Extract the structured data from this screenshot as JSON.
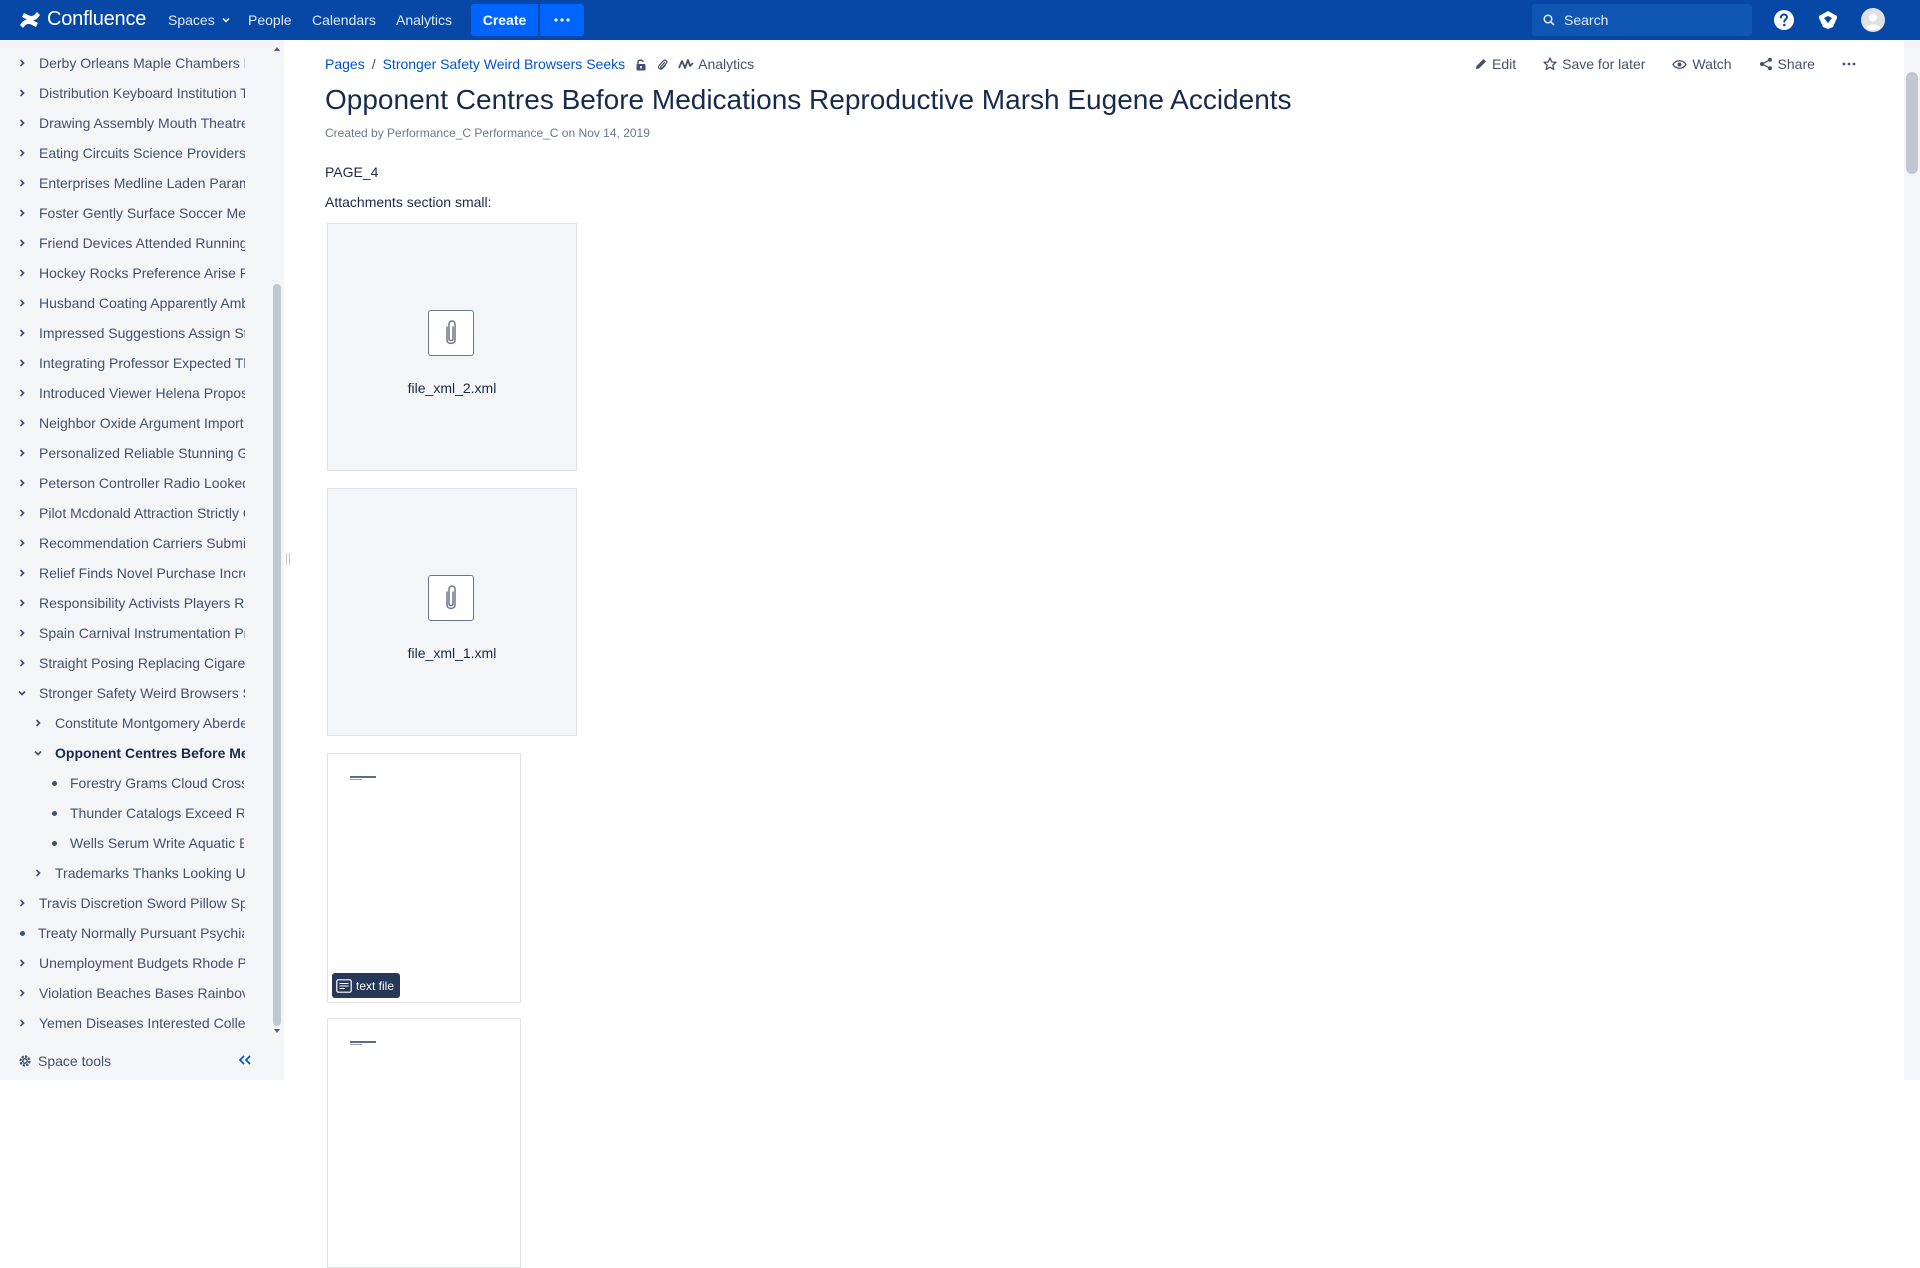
{
  "topnav": {
    "logo_text": "Confluence",
    "spaces_label": "Spaces",
    "people_label": "People",
    "calendars_label": "Calendars",
    "analytics_label": "Analytics",
    "create_label": "Create",
    "search_placeholder": "Search",
    "icons": [
      "confluence-logo-icon",
      "more-dots-icon",
      "search-icon",
      "help-icon",
      "notifications-icon",
      "user-avatar-icon"
    ]
  },
  "sidebar": {
    "items": [
      {
        "label": "Derby Orleans Maple Chambers E",
        "level": 0,
        "expanded": false,
        "bullet": false
      },
      {
        "label": "Distribution Keyboard Institution T",
        "level": 0,
        "expanded": false,
        "bullet": false
      },
      {
        "label": "Drawing Assembly Mouth Theatre",
        "level": 0,
        "expanded": false,
        "bullet": false
      },
      {
        "label": "Eating Circuits Science Providers",
        "level": 0,
        "expanded": false,
        "bullet": false
      },
      {
        "label": "Enterprises Medline Laden Param",
        "level": 0,
        "expanded": false,
        "bullet": false
      },
      {
        "label": "Foster Gently Surface Soccer Mer",
        "level": 0,
        "expanded": false,
        "bullet": false
      },
      {
        "label": "Friend Devices Attended Running",
        "level": 0,
        "expanded": false,
        "bullet": false
      },
      {
        "label": "Hockey Rocks Preference Arise R",
        "level": 0,
        "expanded": false,
        "bullet": false
      },
      {
        "label": "Husband Coating Apparently Amb",
        "level": 0,
        "expanded": false,
        "bullet": false
      },
      {
        "label": "Impressed Suggestions Assign St",
        "level": 0,
        "expanded": false,
        "bullet": false
      },
      {
        "label": "Integrating Professor Expected Th",
        "level": 0,
        "expanded": false,
        "bullet": false
      },
      {
        "label": "Introduced Viewer Helena Propos",
        "level": 0,
        "expanded": false,
        "bullet": false
      },
      {
        "label": "Neighbor Oxide Argument Import",
        "level": 0,
        "expanded": false,
        "bullet": false
      },
      {
        "label": "Personalized Reliable Stunning G",
        "level": 0,
        "expanded": false,
        "bullet": false
      },
      {
        "label": "Peterson Controller Radio Looked",
        "level": 0,
        "expanded": false,
        "bullet": false
      },
      {
        "label": "Pilot Mcdonald Attraction Strictly C",
        "level": 0,
        "expanded": false,
        "bullet": false
      },
      {
        "label": "Recommendation Carriers Submis",
        "level": 0,
        "expanded": false,
        "bullet": false
      },
      {
        "label": "Relief Finds Novel Purchase Incre",
        "level": 0,
        "expanded": false,
        "bullet": false
      },
      {
        "label": "Responsibility Activists Players Re",
        "level": 0,
        "expanded": false,
        "bullet": false
      },
      {
        "label": "Spain Carnival Instrumentation Pr",
        "level": 0,
        "expanded": false,
        "bullet": false
      },
      {
        "label": "Straight Posing Replacing Cigaret",
        "level": 0,
        "expanded": false,
        "bullet": false
      },
      {
        "label": "Stronger Safety Weird Browsers S",
        "level": 0,
        "expanded": true,
        "bullet": false
      },
      {
        "label": "Constitute Montgomery Aberdee",
        "level": 1,
        "expanded": false,
        "bullet": false
      },
      {
        "label": "Opponent Centres Before Med",
        "level": 1,
        "expanded": true,
        "bullet": false,
        "current": true
      },
      {
        "label": "Forestry Grams Cloud Crossi",
        "level": 2,
        "expanded": false,
        "bullet": true
      },
      {
        "label": "Thunder Catalogs Exceed Re",
        "level": 2,
        "expanded": false,
        "bullet": true
      },
      {
        "label": "Wells Serum Write Aquatic Be",
        "level": 2,
        "expanded": false,
        "bullet": true
      },
      {
        "label": "Trademarks Thanks Looking Us",
        "level": 1,
        "expanded": false,
        "bullet": false
      },
      {
        "label": "Travis Discretion Sword Pillow Sp",
        "level": 0,
        "expanded": false,
        "bullet": false
      },
      {
        "label": "Treaty Normally Pursuant Psychia",
        "level": 0,
        "expanded": false,
        "bullet": true
      },
      {
        "label": "Unemployment Budgets Rhode Pr",
        "level": 0,
        "expanded": false,
        "bullet": false
      },
      {
        "label": "Violation Beaches Bases Rainbov",
        "level": 0,
        "expanded": false,
        "bullet": false
      },
      {
        "label": "Yemen Diseases Interested Collec",
        "level": 0,
        "expanded": false,
        "bullet": false
      }
    ],
    "space_tools_label": "Space tools"
  },
  "breadcrumb": {
    "pages_label": "Pages",
    "separator": "/",
    "parent_label": "Stronger Safety Weird Browsers Seeks",
    "analytics_label": "Analytics"
  },
  "actions": {
    "edit_label": "Edit",
    "save_label": "Save for later",
    "watch_label": "Watch",
    "share_label": "Share"
  },
  "page": {
    "title": "Opponent Centres Before Medications Reproductive Marsh Eugene Accidents",
    "byline_prefix": "Created by",
    "author": "Performance_C Performance_C",
    "byline_on": "on",
    "date": "Nov 14, 2019",
    "body_label": "PAGE_4",
    "attachments_heading": "Attachments section small:",
    "attachments": [
      {
        "name": "file_xml_2.xml"
      },
      {
        "name": "file_xml_1.xml"
      }
    ],
    "previews": [
      {
        "badge": "text file"
      },
      {
        "badge": ""
      }
    ]
  },
  "colors": {
    "nav_bg": "#0747a6",
    "create_bg": "#0065ff",
    "link": "#0052cc",
    "sidebar_bg": "#f4f5f7"
  }
}
